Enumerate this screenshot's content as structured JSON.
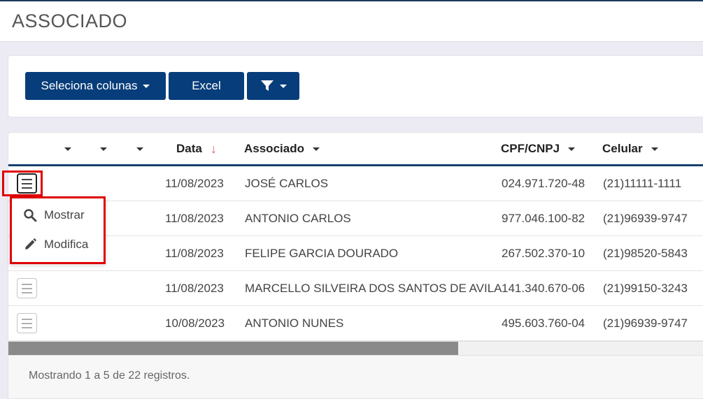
{
  "header": {
    "title": "ASSOCIADO"
  },
  "toolbar": {
    "columns_label": "Seleciona colunas",
    "excel_label": "Excel"
  },
  "table": {
    "columns": {
      "data": "Data",
      "associado": "Associado",
      "cpf": "CPF/CNPJ",
      "celular": "Celular"
    },
    "rows": [
      {
        "data": "11/08/2023",
        "associado": "JOSÉ CARLOS",
        "cpf": "024.971.720-48",
        "celular": "(21)11111-1111"
      },
      {
        "data": "11/08/2023",
        "associado": "ANTONIO CARLOS",
        "cpf": "977.046.100-82",
        "celular": "(21)96939-9747"
      },
      {
        "data": "11/08/2023",
        "associado": "FELIPE GARCIA DOURADO",
        "cpf": "267.502.370-10",
        "celular": "(21)98520-5843"
      },
      {
        "data": "11/08/2023",
        "associado": "MARCELLO SILVEIRA DOS SANTOS DE AVILA",
        "cpf": "141.340.670-06",
        "celular": "(21)99150-3243"
      },
      {
        "data": "10/08/2023",
        "associado": "ANTONIO NUNES",
        "cpf": "495.603.760-04",
        "celular": "(21)96939-9747"
      }
    ]
  },
  "row_menu": {
    "show_label": "Mostrar",
    "edit_label": "Modifica"
  },
  "footer": {
    "info": "Mostrando 1 a 5 de 22 registros."
  },
  "colors": {
    "primary": "#073d7a",
    "highlight": "#e00000",
    "sort_arrow": "#e05555"
  }
}
